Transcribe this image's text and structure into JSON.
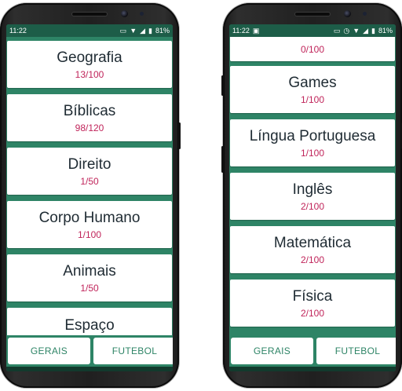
{
  "colors": {
    "accent": "#2e8466",
    "status_bar": "#1d5d48",
    "score": "#c0245a",
    "card": "#ffffff",
    "title": "#1f2b33"
  },
  "phones": [
    {
      "status": {
        "time": "11:22",
        "left_icons": [],
        "right_icons": [
          "vibrate-icon",
          "wifi-icon",
          "signal-icon",
          "battery-icon"
        ],
        "battery": "81%"
      },
      "categories": [
        {
          "name": "Geografia",
          "score": "13/100"
        },
        {
          "name": "Bíblicas",
          "score": "98/120"
        },
        {
          "name": "Direito",
          "score": "1/50"
        },
        {
          "name": "Corpo Humano",
          "score": "1/100"
        },
        {
          "name": "Animais",
          "score": "1/50"
        },
        {
          "name": "Espaço",
          "score": ""
        }
      ],
      "tabs": {
        "gerais": "GERAIS",
        "futebol": "FUTEBOL"
      }
    },
    {
      "status": {
        "time": "11:22",
        "left_icons": [
          "image-icon"
        ],
        "right_icons": [
          "vibrate-icon",
          "alarm-icon",
          "wifi-icon",
          "signal-icon",
          "battery-icon"
        ],
        "battery": "81%"
      },
      "categories": [
        {
          "name": "",
          "score": "0/100"
        },
        {
          "name": "Games",
          "score": "1/100"
        },
        {
          "name": "Língua Portuguesa",
          "score": "1/100"
        },
        {
          "name": "Inglês",
          "score": "2/100"
        },
        {
          "name": "Matemática",
          "score": "2/100"
        },
        {
          "name": "Física",
          "score": "2/100"
        }
      ],
      "tabs": {
        "gerais": "GERAIS",
        "futebol": "FUTEBOL"
      }
    }
  ]
}
